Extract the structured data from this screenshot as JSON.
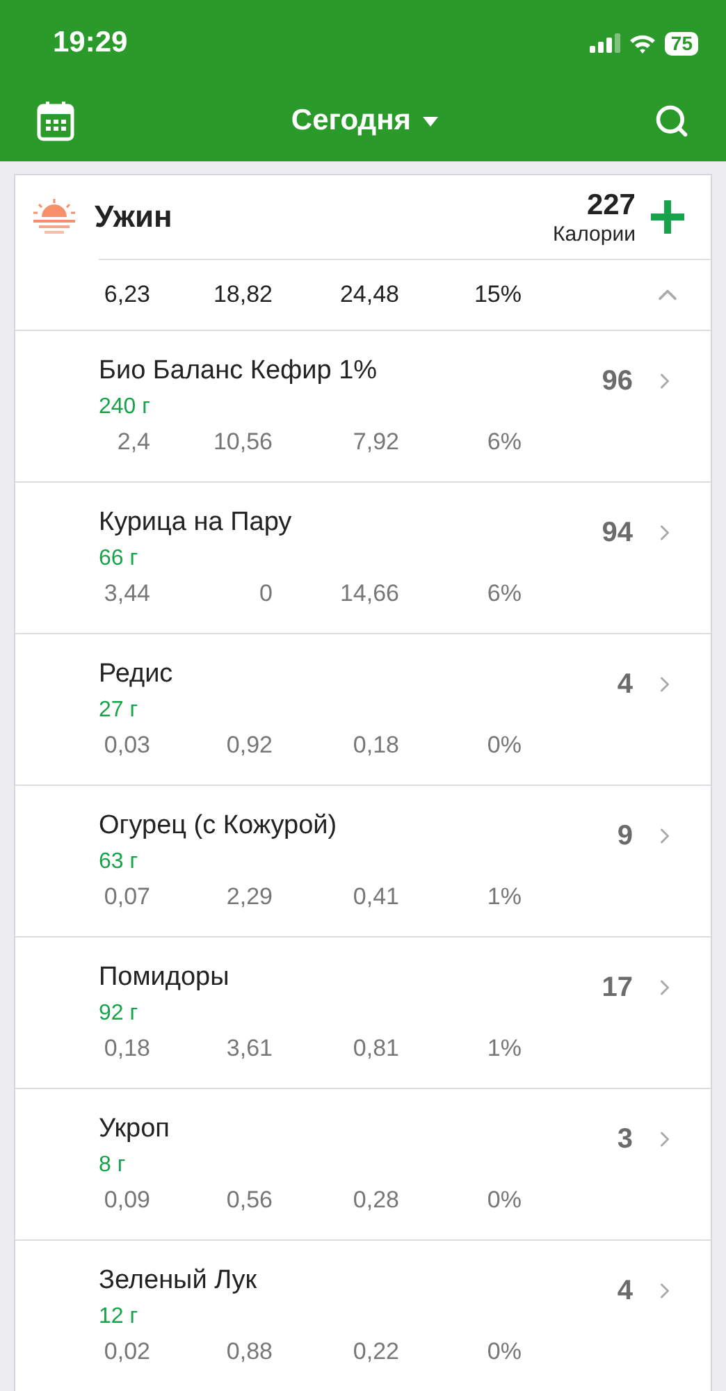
{
  "status_bar": {
    "time": "19:29",
    "battery": "75"
  },
  "nav": {
    "title": "Сегодня"
  },
  "meal": {
    "title": "Ужин",
    "calories": "227",
    "calories_label": "Калории",
    "expanded": true,
    "totals": [
      "6,23",
      "18,82",
      "24,48",
      "15%"
    ]
  },
  "items": [
    {
      "name": "Био Баланс Кефир 1%",
      "amount": "240 г",
      "calories": "96",
      "values": [
        "2,4",
        "10,56",
        "7,92",
        "6%"
      ]
    },
    {
      "name": "Курица на Пару",
      "amount": "66 г",
      "calories": "94",
      "values": [
        "3,44",
        "0",
        "14,66",
        "6%"
      ]
    },
    {
      "name": "Редис",
      "amount": "27 г",
      "calories": "4",
      "values": [
        "0,03",
        "0,92",
        "0,18",
        "0%"
      ]
    },
    {
      "name": "Огурец (с Кожурой)",
      "amount": "63 г",
      "calories": "9",
      "values": [
        "0,07",
        "2,29",
        "0,41",
        "1%"
      ]
    },
    {
      "name": "Помидоры",
      "amount": "92 г",
      "calories": "17",
      "values": [
        "0,18",
        "3,61",
        "0,81",
        "1%"
      ]
    },
    {
      "name": "Укроп",
      "amount": "8 г",
      "calories": "3",
      "values": [
        "0,09",
        "0,56",
        "0,28",
        "0%"
      ]
    },
    {
      "name": "Зеленый Лук",
      "amount": "12 г",
      "calories": "4",
      "values": [
        "0,02",
        "0,88",
        "0,22",
        "0%"
      ]
    }
  ]
}
